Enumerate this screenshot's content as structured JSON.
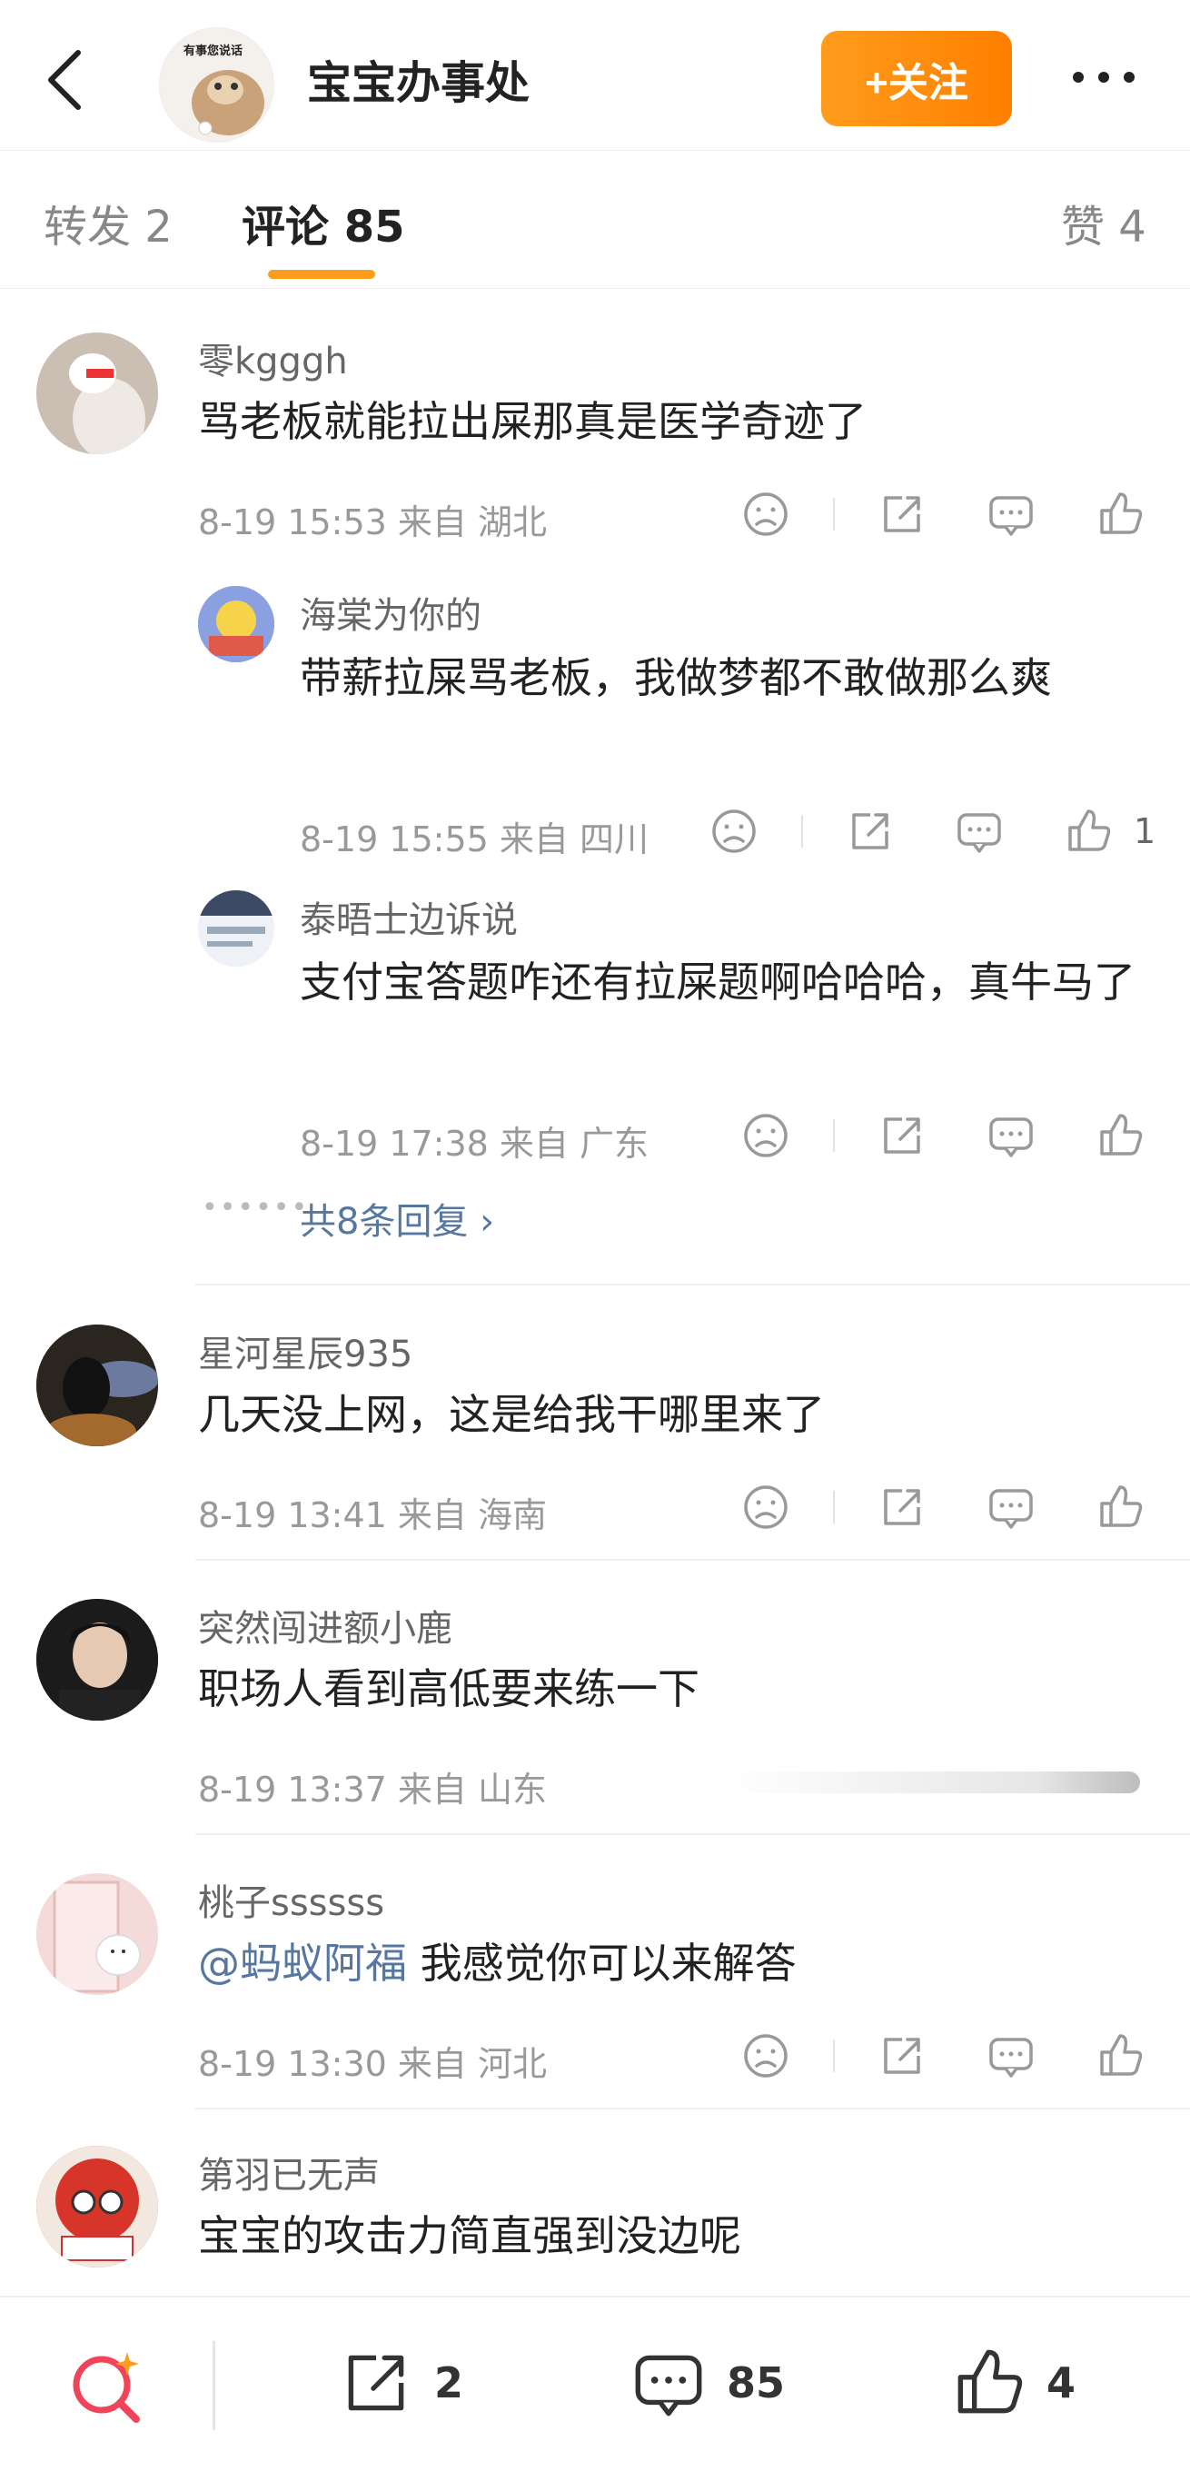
{
  "header": {
    "title": "宝宝办事处",
    "avatar_text": "有事您说话",
    "follow_label": "+关注"
  },
  "tabs": {
    "repost": "转发 2",
    "comments": "评论 85",
    "likes": "赞 4"
  },
  "comments": [
    {
      "name": "零kgggh",
      "text": "骂老板就能拉出屎那真是医学奇迹了",
      "meta": "8-19 15:53  来自 湖北"
    },
    {
      "name": "海棠为你的",
      "text": "带薪拉屎骂老板，我做梦都不敢做那么爽",
      "meta": "8-19 15:55  来自 四川",
      "like_count": "1"
    },
    {
      "name": "泰晤士边诉说",
      "text": "支付宝答题咋还有拉屎题啊哈哈哈，真牛马了",
      "meta": "8-19 17:38  来自 广东"
    },
    {
      "name": "星河星辰935",
      "text": "几天没上网，这是给我干哪里来了",
      "meta": "8-19 13:41  来自 海南"
    },
    {
      "name": "突然闯进额小鹿",
      "text": "职场人看到高低要来练一下",
      "meta": "8-19 13:37  来自 山东"
    },
    {
      "name": "桃子ssssss",
      "mention": "@蚂蚁阿福",
      "text": " 我感觉你可以来解答",
      "meta": "8-19 13:30  来自 河北"
    },
    {
      "name": "第羽已无声",
      "text": "宝宝的攻击力简直强到没边呢"
    }
  ],
  "replies_link": "共8条回复 ›",
  "bottom": {
    "reposts": "2",
    "comments": "85",
    "likes": "4"
  },
  "colors": {
    "accent": "#ff9c1c",
    "link": "#56779f"
  },
  "icons": [
    "back-icon",
    "more-icon",
    "dislike-icon",
    "share-icon",
    "comment-icon",
    "like-icon",
    "search-icon"
  ]
}
